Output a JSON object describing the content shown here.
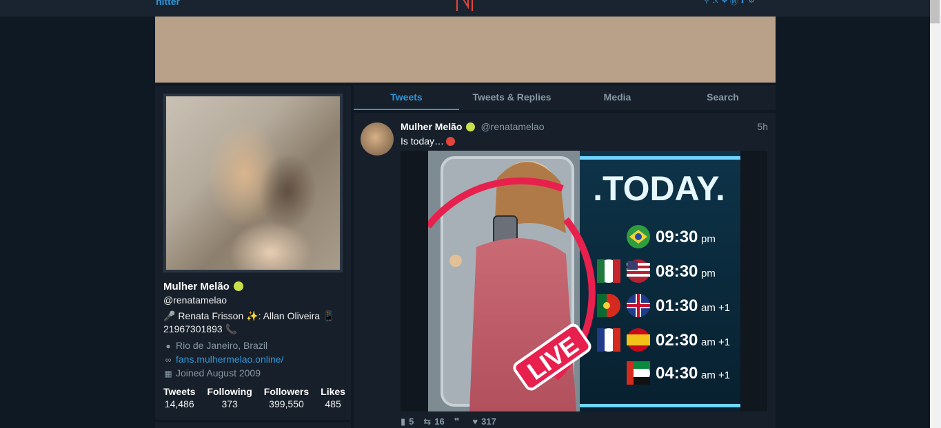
{
  "nav": {
    "brand": "nitter",
    "logo_letter": "N",
    "icons": [
      "search-icon",
      "rss-icon",
      "twitter-icon",
      "pinterest-icon",
      "info-icon",
      "settings-icon"
    ]
  },
  "colors": {
    "accent": "#2f96d8",
    "background": "#0f1923",
    "panel": "#161f2a",
    "banner": "#b8a089",
    "logo": "#e0463c"
  },
  "profile": {
    "name": "Mulher Melão",
    "handle": "@renatamelao",
    "bio_line1": "🎤 Renata Frisson ✨: Allan Oliveira 📱",
    "bio_line2": "21967301893 📞",
    "location": "Rio de Janeiro, Brazil",
    "website": "fans.mulhermelao.online/",
    "joined": "Joined August 2009",
    "stats": [
      {
        "label": "Tweets",
        "value": "14,486"
      },
      {
        "label": "Following",
        "value": "373"
      },
      {
        "label": "Followers",
        "value": "399,550"
      },
      {
        "label": "Likes",
        "value": "485"
      }
    ]
  },
  "tabs": [
    {
      "label": "Tweets",
      "active": true
    },
    {
      "label": "Tweets & Replies",
      "active": false
    },
    {
      "label": "Media",
      "active": false
    },
    {
      "label": "Search",
      "active": false
    }
  ],
  "tweet": {
    "name": "Mulher Melão",
    "handle": "@renatamelao",
    "time": "5h",
    "text": "Is today…",
    "media": {
      "headline": ".TODAY.",
      "badge": "LIVE",
      "schedule": [
        {
          "time": "09:30",
          "suffix": "pm"
        },
        {
          "time": "08:30",
          "suffix": "pm"
        },
        {
          "time": "01:30",
          "suffix": "am +1"
        },
        {
          "time": "02:30",
          "suffix": "am +1"
        },
        {
          "time": "04:30",
          "suffix": "am +1"
        }
      ]
    },
    "stats": {
      "replies": "5",
      "retweets": "16",
      "quotes": "",
      "likes": "317"
    }
  }
}
